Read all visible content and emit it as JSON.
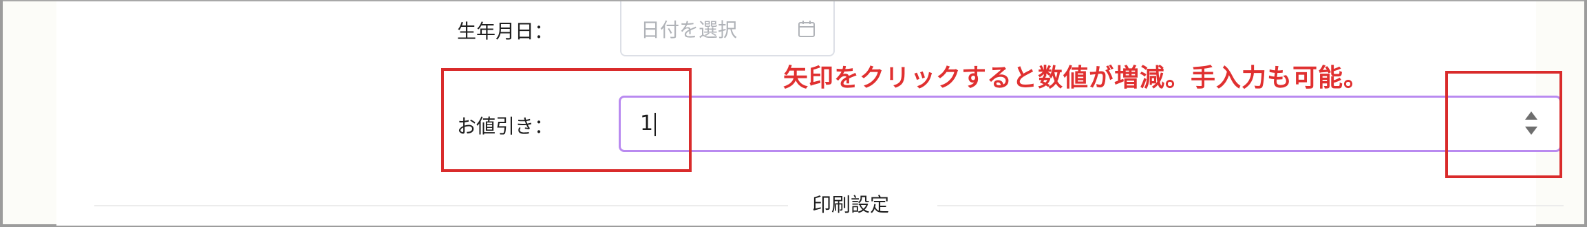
{
  "form": {
    "birthdate": {
      "label": "生年月日：",
      "placeholder": "日付を選択",
      "icon": "calendar-icon"
    },
    "discount": {
      "label": "お値引き：",
      "value": "1",
      "spinner_icons": [
        "caret-up-icon",
        "caret-down-icon"
      ]
    }
  },
  "annotation": {
    "text": "矢印をクリックすると数値が増減。手入力も可能。",
    "color": "#e03030"
  },
  "section_divider": {
    "label": "印刷設定"
  },
  "colors": {
    "focus_border": "#b98af0",
    "highlight_box": "#d92b2b"
  }
}
